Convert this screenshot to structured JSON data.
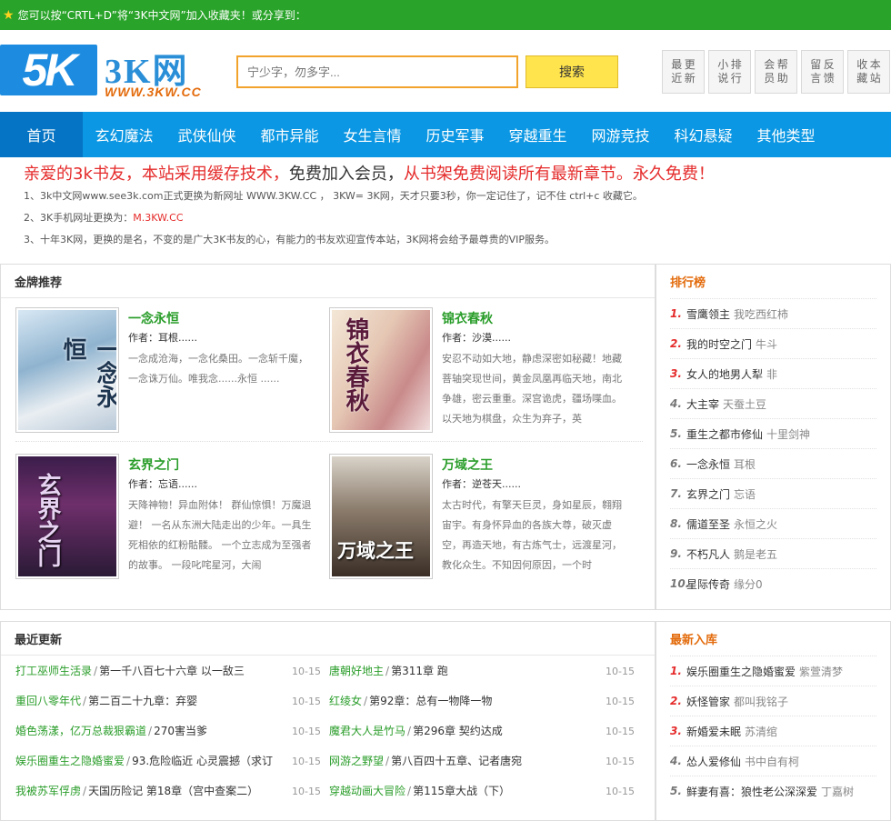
{
  "topbar": {
    "text": "您可以按“CRTL+D”将“3K中文网”加入收藏夹！或分享到："
  },
  "logo": {
    "mark": "5K",
    "name": "3K网",
    "url": "WWW.3KW.CC"
  },
  "search": {
    "placeholder": "宁少字，勿多字...",
    "button": "搜索"
  },
  "quick": [
    [
      "最近",
      "更新"
    ],
    [
      "小说",
      "排行"
    ],
    [
      "会员",
      "帮助"
    ],
    [
      "留言",
      "反馈"
    ],
    [
      "收藏",
      "本站"
    ]
  ],
  "nav": [
    "首页",
    "玄幻魔法",
    "武侠仙侠",
    "都市异能",
    "女生言情",
    "历史军事",
    "穿越重生",
    "网游竞技",
    "科幻悬疑",
    "其他类型"
  ],
  "notice": {
    "headline_a": "亲爱的3k书友，本站采用缓存技术，",
    "headline_b": "免费加入会员，",
    "headline_c": "从书架免费阅读所有最新章节。永久免费！",
    "line1": "1、3k中文网www.see3k.com正式更换为新网址 WWW.3KW.CC ， 3KW= 3K网，天才只要3秒，你一定记住了，记不住 ctrl+c 收藏它。",
    "line2_a": "2、3K手机网址更换为：",
    "line2_b": "M.3KW.CC",
    "line3": "3、十年3K网，更换的是名，不变的是广大3K书友的心，有能力的书友欢迎宣传本站，3K网将会给予最尊贵的VIP服务。"
  },
  "featured": {
    "title": "金牌推荐",
    "books": [
      {
        "title": "一念永恒",
        "author": "作者：耳根......",
        "desc": "一念成沧海，一念化桑田。一念斩千魔，一念诛万仙。唯我念......永恒 ......",
        "cover_text": "一念永恒"
      },
      {
        "title": "锦衣春秋",
        "author": "作者：沙漠......",
        "desc": "安忍不动如大地，静虑深密如秘藏！地藏菩轴突现世间，黄金凤凰再临天地，南北争雄，密云重重。深宫诡虎，疆场喋血。以天地为棋盘，众生为弃子，英",
        "cover_text": "锦衣春秋"
      },
      {
        "title": "玄界之门",
        "author": "作者：忘语......",
        "desc": "天降神物！异血附体！ 群仙惊惧！万魔退避！ 一名从东洲大陆走出的少年。一具生死相依的红粉骷髅。 一个立志成为至强者的故事。 一段叱咤星河，大闹",
        "cover_text": "玄界之门"
      },
      {
        "title": "万域之王",
        "author": "作者：逆苍天......",
        "desc": "太古时代，有擎天巨灵，身如星辰，翱翔宙宇。有身怀异血的各族大尊，破灭虚空，再造天地，有古炼气士，远渡星河，教化众生。不知因何原因，一个时",
        "cover_text": "万域之王"
      }
    ]
  },
  "ranking": {
    "title": "排行榜",
    "items": [
      {
        "num": "1.",
        "title": "雪鹰领主",
        "author": "我吃西红柿"
      },
      {
        "num": "2.",
        "title": "我的时空之门",
        "author": "牛斗"
      },
      {
        "num": "3.",
        "title": "女人的地男人犁",
        "author": "非"
      },
      {
        "num": "4.",
        "title": "大主宰",
        "author": "天蚕土豆"
      },
      {
        "num": "5.",
        "title": "重生之都市修仙",
        "author": "十里剑神"
      },
      {
        "num": "6.",
        "title": "一念永恒",
        "author": "耳根"
      },
      {
        "num": "7.",
        "title": "玄界之门",
        "author": "忘语"
      },
      {
        "num": "8.",
        "title": "儒道至圣",
        "author": "永恒之火"
      },
      {
        "num": "9.",
        "title": "不朽凡人",
        "author": "鹅是老五"
      },
      {
        "num": "10.",
        "title": "星际传奇",
        "author": "缘分0"
      }
    ]
  },
  "updates": {
    "title": "最近更新",
    "left": [
      {
        "title": "打工巫师生活录",
        "chapter": "第一千八百七十六章 以一敌三",
        "date": "10-15"
      },
      {
        "title": "重回八零年代",
        "chapter": "第二百二十九章：弃婴",
        "date": "10-15"
      },
      {
        "title": "婚色荡漾，亿万总裁狠霸道",
        "chapter": "270害当爹",
        "date": "10-15"
      },
      {
        "title": "娱乐圈重生之隐婚蜜爱",
        "chapter": "93.危险临近 心灵震撼（求订",
        "date": "10-15"
      },
      {
        "title": "我被苏军俘虏",
        "chapter": "天国历险记 第18章（宫中查案二）",
        "date": "10-15"
      }
    ],
    "right": [
      {
        "title": "唐朝好地主",
        "chapter": "第311章 跑",
        "date": "10-15"
      },
      {
        "title": "红绫女",
        "chapter": "第92章：总有一物降一物",
        "date": "10-15"
      },
      {
        "title": "魔君大人是竹马",
        "chapter": "第296章 契约达成",
        "date": "10-15"
      },
      {
        "title": "网游之野望",
        "chapter": "第八百四十五章、记者唐宛",
        "date": "10-15"
      },
      {
        "title": "穿越动画大冒险",
        "chapter": "第115章大战（下）",
        "date": "10-15"
      }
    ]
  },
  "newbooks": {
    "title": "最新入库",
    "items": [
      {
        "num": "1.",
        "title": "娱乐圈重生之隐婚蜜爱",
        "author": "紫萱清梦"
      },
      {
        "num": "2.",
        "title": "妖怪管家",
        "author": "都叫我铭子"
      },
      {
        "num": "3.",
        "title": "新婚爱未眠",
        "author": "苏清绾"
      },
      {
        "num": "4.",
        "title": "怂人爱修仙",
        "author": "书中自有柯"
      },
      {
        "num": "5.",
        "title": "鲜妻有喜：狼性老公深深爱",
        "author": "丁嘉树"
      }
    ]
  }
}
